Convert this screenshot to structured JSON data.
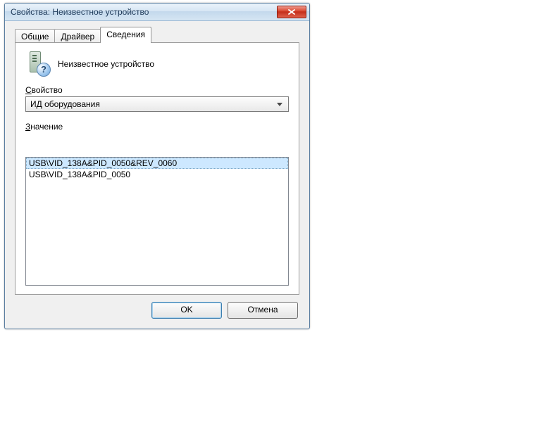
{
  "window": {
    "title": "Свойства: Неизвестное устройство"
  },
  "tabs": {
    "general": "Общие",
    "driver": "Драйвер",
    "details": "Сведения"
  },
  "device": {
    "name": "Неизвестное устройство"
  },
  "labels": {
    "property_prefix": "С",
    "property_rest": "войство",
    "value_prefix": "З",
    "value_rest": "начение"
  },
  "combo": {
    "selected": "ИД оборудования"
  },
  "values": [
    "USB\\VID_138A&PID_0050&REV_0060",
    "USB\\VID_138A&PID_0050"
  ],
  "buttons": {
    "ok": "OK",
    "cancel": "Отмена"
  },
  "icon_labels": {
    "question": "?"
  }
}
